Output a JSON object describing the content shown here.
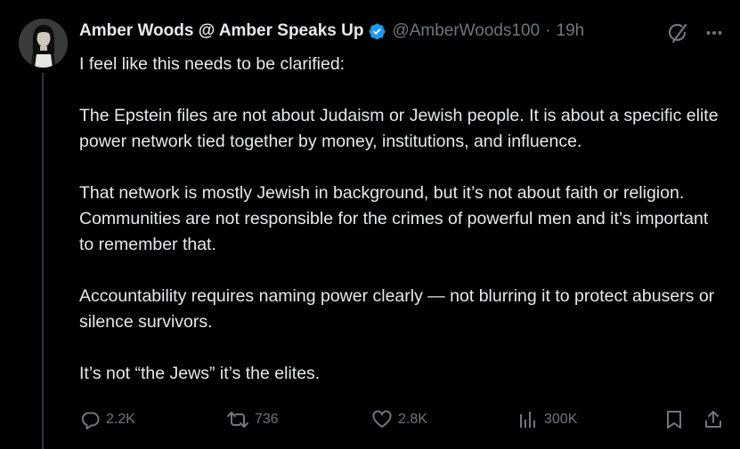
{
  "author": {
    "display_name": "Amber Woods @ Amber Speaks Up",
    "handle": "@AmberWoods100",
    "separator": "·",
    "time": "19h",
    "verified": true
  },
  "tweet": {
    "paragraphs": [
      "I feel like this needs to be clarified:",
      "The Epstein files are not about Judaism or Jewish people. It is about a specific elite power network tied together by money, institutions, and influence.",
      "That network is mostly Jewish in background, but it’s not about faith or religion. Communities are not responsible for the crimes of powerful men and it’s important to remember that.",
      "Accountability requires naming power clearly — not blurring it to protect abusers or silence survivors.",
      "It’s not “the Jews” it’s the elites."
    ]
  },
  "actions": {
    "replies": "2.2K",
    "reposts": "736",
    "likes": "2.8K",
    "views": "300K"
  },
  "icons": {
    "verified": "verified-badge-icon",
    "grok": "grok-icon",
    "more": "more-icon",
    "reply": "reply-icon",
    "repost": "repost-icon",
    "like": "heart-icon",
    "views": "views-icon",
    "bookmark": "bookmark-icon",
    "share": "share-icon"
  },
  "colors": {
    "background": "#000000",
    "primary_text": "#e7e9ea",
    "secondary_text": "#71767b",
    "verified_blue": "#1d9bf0"
  }
}
